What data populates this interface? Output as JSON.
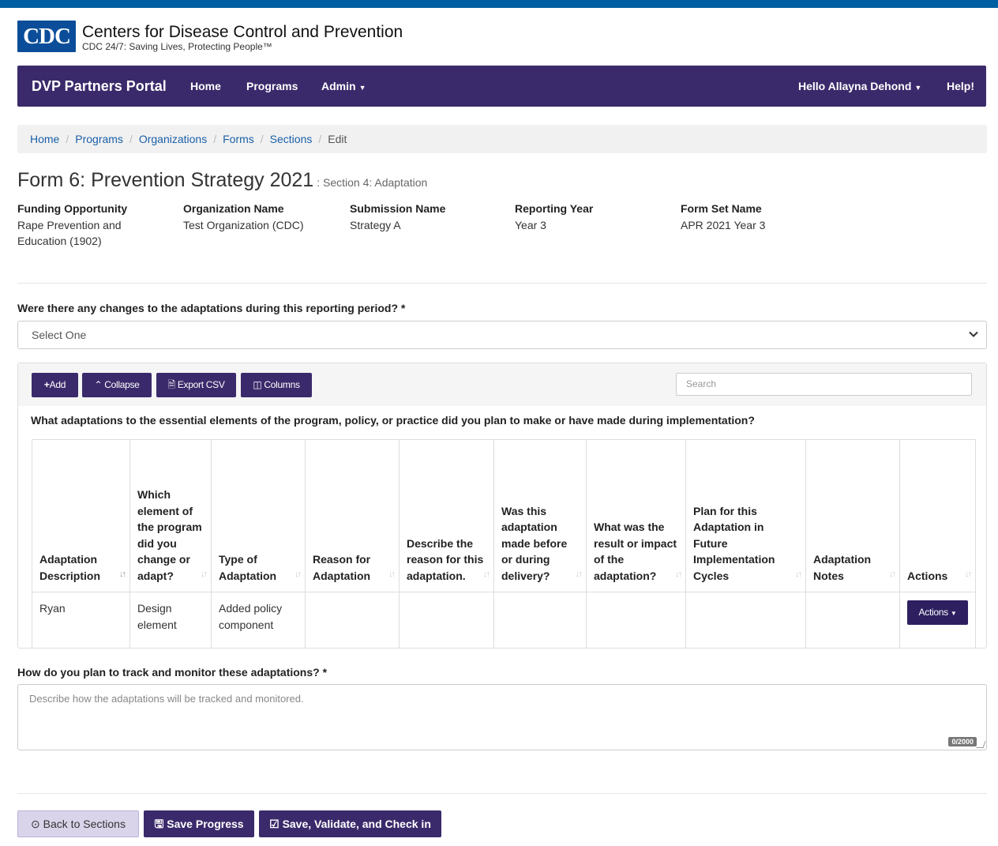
{
  "logo": {
    "abbr": "CDC",
    "title": "Centers for Disease Control and Prevention",
    "tagline": "CDC 24/7: Saving Lives, Protecting People™"
  },
  "nav": {
    "brand": "DVP Partners Portal",
    "home": "Home",
    "programs": "Programs",
    "admin": "Admin",
    "user": "Hello Allayna Dehond",
    "help": "Help!"
  },
  "breadcrumb": [
    "Home",
    "Programs",
    "Organizations",
    "Forms",
    "Sections",
    "Edit"
  ],
  "page": {
    "title": "Form 6: Prevention Strategy 2021",
    "subtitle": ": Section 4: Adaptation"
  },
  "meta": [
    {
      "label": "Funding Opportunity",
      "value": "Rape Prevention and Education (1902)"
    },
    {
      "label": "Organization Name",
      "value": "Test Organization (CDC)"
    },
    {
      "label": "Submission Name",
      "value": "Strategy A"
    },
    {
      "label": "Reporting Year",
      "value": "Year 3"
    },
    {
      "label": "Form Set Name",
      "value": "APR 2021 Year 3"
    }
  ],
  "q1": {
    "label": "Were there any changes to the adaptations during this reporting period? *",
    "selected": "Select One"
  },
  "toolbar": {
    "add": "Add",
    "collapse": "Collapse",
    "export": "Export CSV",
    "columns": "Columns",
    "search_placeholder": "Search"
  },
  "table": {
    "question": "What adaptations to the essential elements of the program, policy, or practice did you plan to make or have made during implementation?",
    "headers": [
      "Adaptation Description",
      "Which element of the program did you change or adapt?",
      "Type of Adaptation",
      "Reason for Adaptation",
      "Describe the reason for this adaptation.",
      "Was this adaptation made before or during delivery?",
      "What was the result or impact of the adaptation?",
      "Plan for this Adaptation in Future Implementation Cycles",
      "Adaptation Notes",
      "Actions"
    ],
    "rows": [
      [
        "Ryan",
        "Design element",
        "Added policy component",
        "",
        "",
        "",
        "",
        "",
        "",
        ""
      ]
    ],
    "row_action_label": "Actions"
  },
  "q2": {
    "label": "How do you plan to track and monitor these adaptations? *",
    "placeholder": "Describe how the adaptations will be tracked and monitored.",
    "counter": "0/2000"
  },
  "footer": {
    "back": "Back to Sections",
    "save": "Save Progress",
    "validate": "Save, Validate, and Check in"
  },
  "colors": {
    "nav_bg": "#3b2a6b",
    "top_bar": "#005ea2",
    "link": "#1a5fa8"
  }
}
